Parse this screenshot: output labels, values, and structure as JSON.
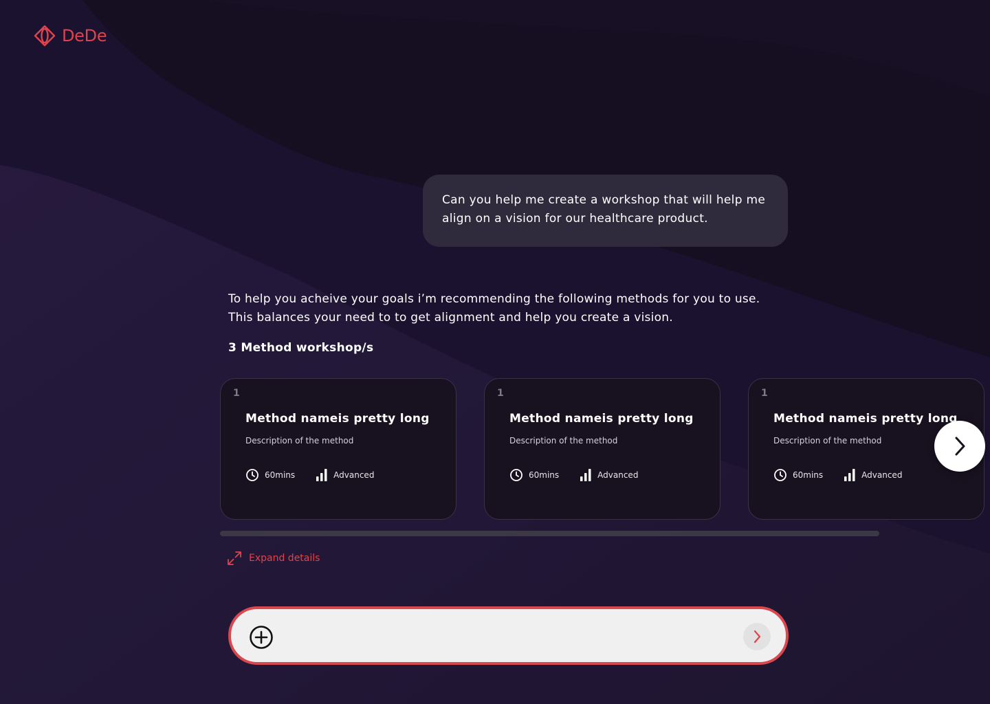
{
  "brand": {
    "name": "DeDe",
    "accent_color": "#e0434d"
  },
  "user_message": "Can you help me create a workshop that will help me align on a vision for our healthcare product.",
  "assistant_reply": {
    "line1": "To help you acheive your goals i’m recommending the following methods for you to use.",
    "line2": "This balances your need to  to get alignment and help you create a vision."
  },
  "workshop_title": "3 Method workshop/s",
  "methods": [
    {
      "number": "1",
      "name": "Method nameis pretty long",
      "description": "Description of the method",
      "duration": "60mins",
      "level": "Advanced"
    },
    {
      "number": "1",
      "name": "Method nameis pretty long",
      "description": "Description of the method",
      "duration": "60mins",
      "level": "Advanced"
    },
    {
      "number": "1",
      "name": "Method nameis pretty long",
      "description": "Description of the method",
      "duration": "60mins",
      "level": "Advanced"
    }
  ],
  "expand_label": "Expand details",
  "chat_input": {
    "value": "",
    "placeholder": ""
  },
  "icons": {
    "logo": "dede-logo-icon",
    "next": "chevron-right-icon",
    "clock": "clock-icon",
    "level": "signal-bars-icon",
    "expand": "expand-arrows-icon",
    "add": "plus-circle-icon",
    "send": "send-chevron-icon"
  }
}
